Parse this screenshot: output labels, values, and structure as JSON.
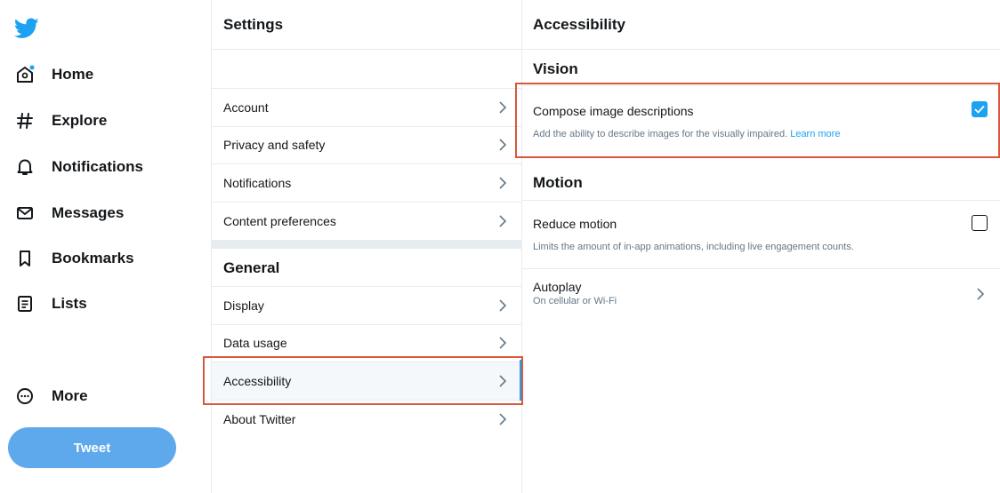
{
  "nav": {
    "items": [
      {
        "label": "Home",
        "icon": "home-icon"
      },
      {
        "label": "Explore",
        "icon": "hashtag-icon"
      },
      {
        "label": "Notifications",
        "icon": "bell-icon"
      },
      {
        "label": "Messages",
        "icon": "envelope-icon"
      },
      {
        "label": "Bookmarks",
        "icon": "bookmark-icon"
      },
      {
        "label": "Lists",
        "icon": "list-icon"
      }
    ],
    "more_label": "More",
    "tweet_label": "Tweet"
  },
  "settings": {
    "title": "Settings",
    "rows": [
      {
        "label": "Account"
      },
      {
        "label": "Privacy and safety"
      },
      {
        "label": "Notifications"
      },
      {
        "label": "Content preferences"
      }
    ],
    "general_title": "General",
    "general_rows": [
      {
        "label": "Display"
      },
      {
        "label": "Data usage"
      },
      {
        "label": "Accessibility",
        "active": true
      },
      {
        "label": "About Twitter"
      }
    ]
  },
  "accessibility": {
    "title": "Accessibility",
    "vision": {
      "title": "Vision",
      "option_title": "Compose image descriptions",
      "option_desc": "Add the ability to describe images for the visually impaired.",
      "learn_more": "Learn more",
      "checked": true
    },
    "motion": {
      "title": "Motion",
      "option_title": "Reduce motion",
      "option_desc": "Limits the amount of in-app animations, including live engagement counts.",
      "checked": false
    },
    "autoplay": {
      "title": "Autoplay",
      "value": "On cellular or Wi-Fi"
    }
  },
  "colors": {
    "accent": "#1da1f2",
    "tweet_button": "#5ea8ec",
    "highlight_border": "#d9573c"
  }
}
